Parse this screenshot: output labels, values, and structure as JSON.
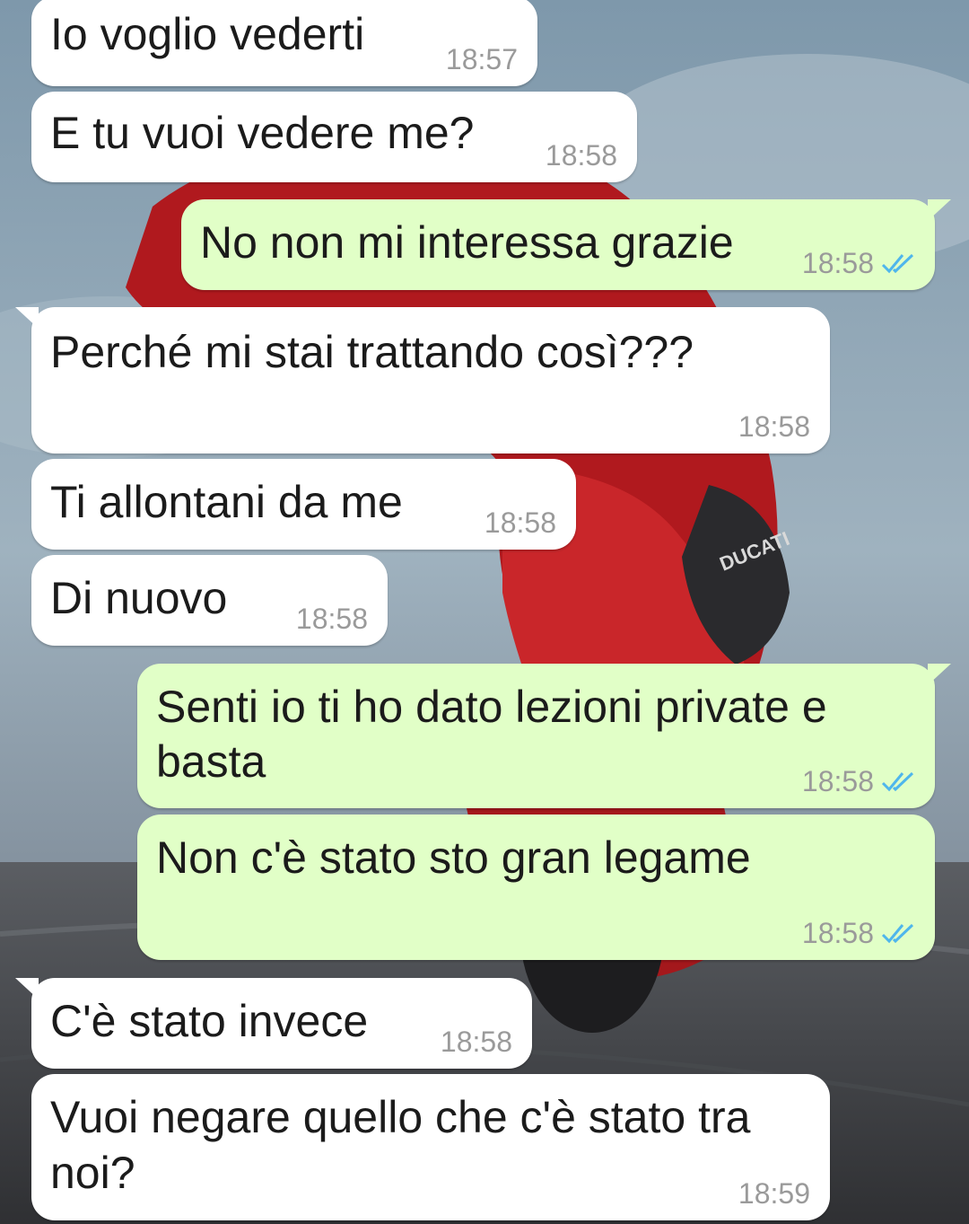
{
  "messages": [
    {
      "dir": "in",
      "text": "Io voglio vederti",
      "time": "18:57"
    },
    {
      "dir": "in",
      "text": "E tu vuoi vedere me?",
      "time": "18:58"
    },
    {
      "dir": "out",
      "text": "No non mi interessa grazie",
      "time": "18:58",
      "status": "read"
    },
    {
      "dir": "in",
      "text": "Perché mi stai trattando così???",
      "time": "18:58"
    },
    {
      "dir": "in",
      "text": "Ti allontani da me",
      "time": "18:58"
    },
    {
      "dir": "in",
      "text": "Di nuovo",
      "time": "18:58"
    },
    {
      "dir": "out",
      "text": "Senti io ti ho dato lezioni private e",
      "text2": "basta",
      "time": "18:58",
      "status": "read"
    },
    {
      "dir": "out",
      "text": "Non c'è stato sto gran legame",
      "time": "18:58",
      "status": "read"
    },
    {
      "dir": "in",
      "text": "C'è stato invece",
      "time": "18:58"
    },
    {
      "dir": "in",
      "text": "Vuoi negare quello che c'è stato tra",
      "text2": "noi?",
      "time": "18:59"
    }
  ],
  "colors": {
    "incoming": "#ffffff",
    "outgoing": "#e1ffc7",
    "read_tick": "#4fb6ec",
    "time": "#9a9a9a"
  },
  "wallpaper": {
    "subject": "red motorcycle leaning on track",
    "logo_text": "DUCATI"
  }
}
